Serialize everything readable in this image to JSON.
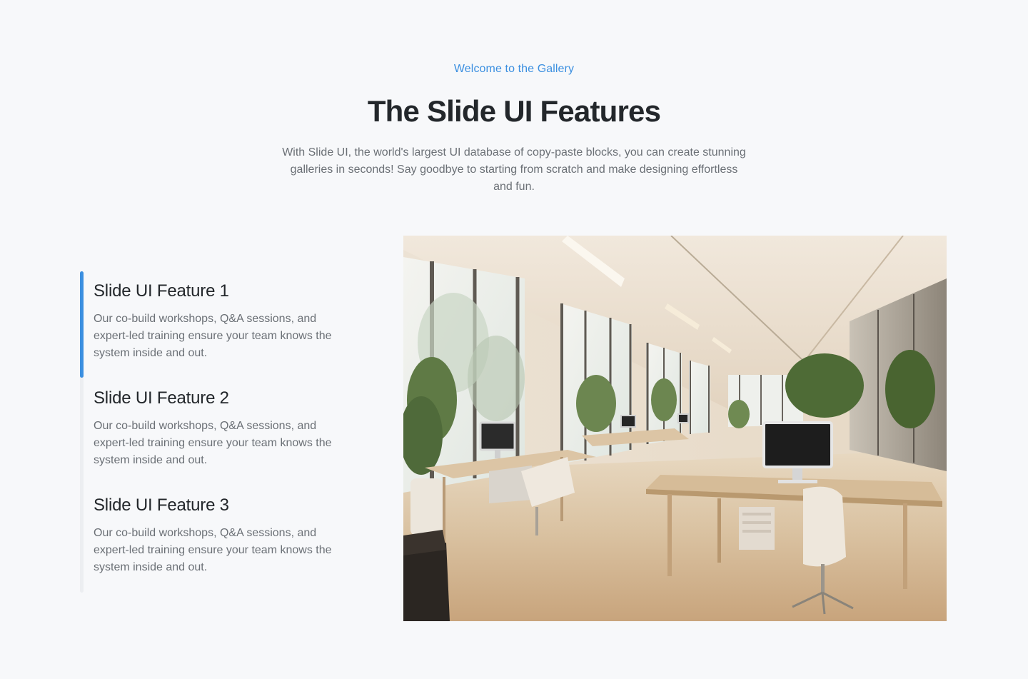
{
  "header": {
    "eyebrow": "Welcome to the Gallery",
    "title": "The Slide UI Features",
    "subtitle": "With Slide UI, the world's largest UI database of copy-paste blocks, you can create stunning galleries in seconds! Say goodbye to starting from scratch and make designing effortless and fun."
  },
  "features": [
    {
      "title": "Slide UI Feature 1",
      "description": "Our co-build workshops, Q&A sessions, and expert-led training ensure your team knows the system inside and out.",
      "active": true
    },
    {
      "title": "Slide UI Feature 2",
      "description": "Our co-build workshops, Q&A sessions, and expert-led training ensure your team knows the system inside and out.",
      "active": false
    },
    {
      "title": "Slide UI Feature 3",
      "description": "Our co-build workshops, Q&A sessions, and expert-led training ensure your team knows the system inside and out.",
      "active": false
    }
  ],
  "image": {
    "subject": "office-interior-photo"
  },
  "colors": {
    "accent": "#3b8fe0",
    "background": "#f7f8fa",
    "heading": "#23272b",
    "body": "#6b7076"
  }
}
